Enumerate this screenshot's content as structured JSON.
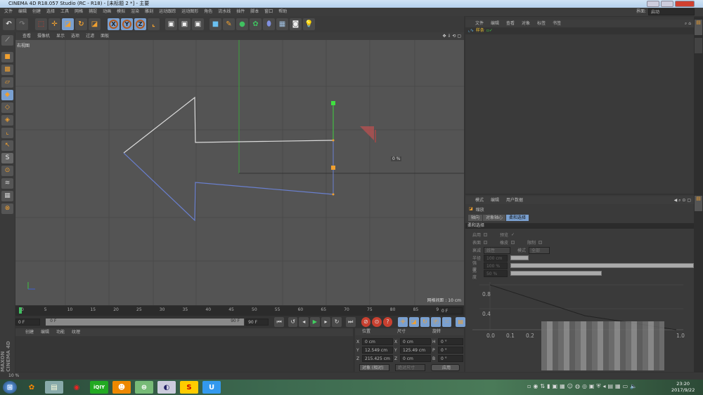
{
  "window": {
    "title": "CINEMA 4D R18.057 Studio (RC - R18) - [未标题 2 *] - 主要"
  },
  "menu": [
    "文件",
    "编辑",
    "创建",
    "选择",
    "工具",
    "网格",
    "捕捉",
    "动画",
    "模拟",
    "渲染",
    "雕刻",
    "运动跟踪",
    "运动图形",
    "角色",
    "流水线",
    "插件",
    "脚本",
    "窗口",
    "帮助"
  ],
  "layout": {
    "label": "界面:",
    "value": "启动"
  },
  "viewport": {
    "menu": [
      "查看",
      "摄像机",
      "显示",
      "选项",
      "过滤",
      "面板"
    ],
    "name": "右视图",
    "grid_spacing": "网格间距 : 10 cm",
    "handle_label": "0 %"
  },
  "object_manager": {
    "menu": [
      "文件",
      "编辑",
      "查看",
      "对象",
      "标签",
      "书签"
    ],
    "objects": [
      {
        "name": "样条"
      }
    ]
  },
  "attributes": {
    "menu": [
      "模式",
      "编辑",
      "用户数据"
    ],
    "tool": "缩放",
    "tabs": [
      "轴向",
      "对象轴心",
      "柔和选择"
    ],
    "active_tab": "柔和选择",
    "section": "柔和选择",
    "enable": "启用",
    "preview": "预览",
    "surface": "表面",
    "rubber": "橡皮",
    "restrict": "限制",
    "falloff_label": "衰减",
    "falloff_value": "线性",
    "mode_label": "模式",
    "mode_value": "全部",
    "radius_label": "半径",
    "radius_value": "100 cm",
    "strength_label": "强度",
    "strength_value": "100 %",
    "strength_pct": 100,
    "width_label": "宽度",
    "width_value": "50 %",
    "width_pct": 50,
    "graph": {
      "y_ticks": [
        "0.8",
        "0.4"
      ],
      "x_ticks": [
        "0.0",
        "0.1",
        "0.2",
        "1.0"
      ]
    }
  },
  "timeline": {
    "ticks": [
      "0",
      "5",
      "10",
      "15",
      "20",
      "25",
      "30",
      "35",
      "40",
      "45",
      "50",
      "55",
      "60",
      "65",
      "70",
      "75",
      "80",
      "85",
      "90"
    ],
    "end_field": "0 F",
    "start": "0 F",
    "range_start": "0 F",
    "range_end": "90 F",
    "max": "90 F"
  },
  "material": {
    "menu": [
      "创建",
      "编辑",
      "功能",
      "纹理"
    ]
  },
  "coords": {
    "headers": [
      "位置",
      "尺寸",
      "旋转"
    ],
    "rows": [
      {
        "a": "X",
        "pos": "0 cm",
        "b": "X",
        "size": "0 cm",
        "c": "H",
        "rot": "0 °"
      },
      {
        "a": "Y",
        "pos": "12.549 cm",
        "b": "Y",
        "size": "125.49 cm",
        "c": "P",
        "rot": "0 °"
      },
      {
        "a": "Z",
        "pos": "215.425 cm",
        "b": "Z",
        "size": "0 cm",
        "c": "B",
        "rot": "0 °"
      }
    ],
    "mode": "对象 (相对)",
    "size_mode": "绝对尺寸",
    "apply": "应用"
  },
  "status": "10 %",
  "brand": "MAXON CINEMA 4D",
  "clock": {
    "time": "23:20",
    "date": "2017/9/22"
  },
  "colors": {
    "accent": "#7aa0d0",
    "orange": "#f0a030",
    "viewport": "#545454"
  }
}
